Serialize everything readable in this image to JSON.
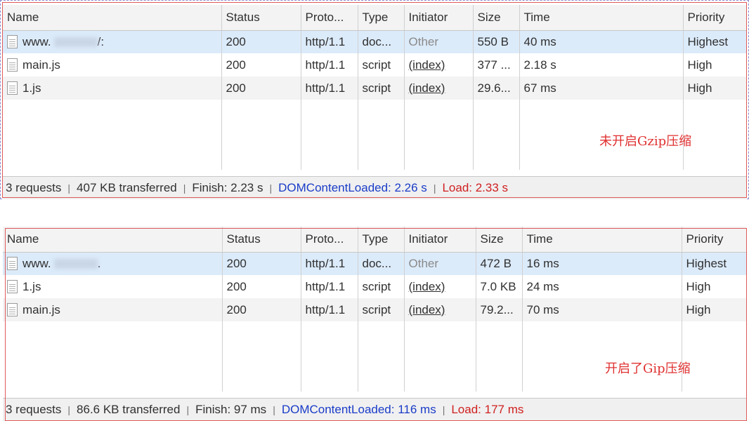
{
  "columns": [
    "Name",
    "Status",
    "Proto...",
    "Type",
    "Initiator",
    "Size",
    "Time",
    "Priority"
  ],
  "panels": [
    {
      "annotation": "未开启Gzip压缩",
      "rows": [
        {
          "name": "www.",
          "name_suffix": "/:",
          "status": "200",
          "protocol": "http/1.1",
          "type": "doc...",
          "initiator": "Other",
          "size": "550 B",
          "time": "40 ms",
          "priority": "Highest"
        },
        {
          "name": "main.js",
          "status": "200",
          "protocol": "http/1.1",
          "type": "script",
          "initiator": "(index)",
          "size": "377 ...",
          "time": "2.18 s",
          "priority": "High"
        },
        {
          "name": "1.js",
          "status": "200",
          "protocol": "http/1.1",
          "type": "script",
          "initiator": "(index)",
          "size": "29.6...",
          "time": "67 ms",
          "priority": "High"
        }
      ],
      "summary": {
        "requests": "3 requests",
        "transferred": "407 KB transferred",
        "finish": "Finish: 2.23 s",
        "dcl": "DOMContentLoaded: 2.26 s",
        "load": "Load: 2.33 s"
      }
    },
    {
      "annotation": "开启了Gip压缩",
      "rows": [
        {
          "name": "www.",
          "name_suffix": ".",
          "status": "200",
          "protocol": "http/1.1",
          "type": "doc...",
          "initiator": "Other",
          "size": "472 B",
          "time": "16 ms",
          "priority": "Highest"
        },
        {
          "name": "1.js",
          "status": "200",
          "protocol": "http/1.1",
          "type": "script",
          "initiator": "(index)",
          "size": "7.0 KB",
          "time": "24 ms",
          "priority": "High"
        },
        {
          "name": "main.js",
          "status": "200",
          "protocol": "http/1.1",
          "type": "script",
          "initiator": "(index)",
          "size": "79.2...",
          "time": "70 ms",
          "priority": "High"
        }
      ],
      "summary": {
        "requests": "3 requests",
        "transferred": "86.6 KB transferred",
        "finish": "Finish: 97 ms",
        "dcl": "DOMContentLoaded: 116 ms",
        "load": "Load: 177 ms"
      }
    }
  ],
  "colors": {
    "selected_row": "#dcebfa",
    "dcl_text": "#1a3cc8",
    "load_text": "#d02020",
    "annotation": "#e03030",
    "frame": "#e05a5a"
  }
}
